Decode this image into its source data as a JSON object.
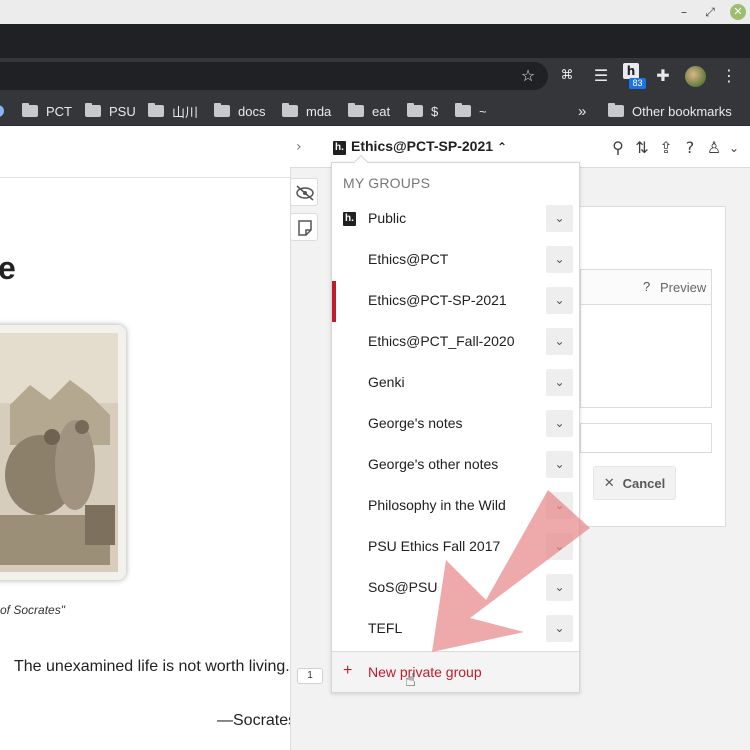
{
  "window": {
    "minimize": "–",
    "maximize": "⤢",
    "close": "✕"
  },
  "toolbar": {
    "star_icon": "☆",
    "ext_icons": [
      "⌘",
      "☰",
      "h"
    ],
    "ext_badge": "83",
    "puzzle_icon": "✚",
    "menu_icon": "⋮"
  },
  "bookmarks": {
    "items": [
      {
        "label": "PCT"
      },
      {
        "label": "PSU"
      },
      {
        "label": "山川"
      },
      {
        "label": "docs"
      },
      {
        "label": "mda"
      },
      {
        "label": "eat"
      },
      {
        "label": "$"
      },
      {
        "label": "~"
      }
    ],
    "overflow": "»",
    "other_label": "Other bookmarks"
  },
  "page": {
    "heading_fragment": "e",
    "caption": "of Socrates\"",
    "quote": "The unexamined life is not worth living.",
    "quote_source": "—Socrates",
    "annotation_count": "1"
  },
  "sidebar": {
    "collapse_icon": "›",
    "group_selector": {
      "name": "Ethics@PCT-SP-2021",
      "chevron": "⌃"
    },
    "icons": {
      "search": "⚲",
      "sort": "⇅",
      "share": "⇪",
      "help": "?",
      "user": "♙",
      "user_chevron": "⌄"
    },
    "menu": {
      "heading": "MY GROUPS",
      "groups": [
        {
          "label": "Public"
        },
        {
          "label": "Ethics@PCT"
        },
        {
          "label": "Ethics@PCT-SP-2021"
        },
        {
          "label": "Ethics@PCT_Fall-2020"
        },
        {
          "label": "Genki"
        },
        {
          "label": "George's notes"
        },
        {
          "label": "George's other notes"
        },
        {
          "label": "Philosophy in the Wild"
        },
        {
          "label": "PSU Ethics Fall 2017"
        },
        {
          "label": "SoS@PSU"
        },
        {
          "label": "TEFL"
        }
      ],
      "submenu_icon": "⌄",
      "new_group_plus": "+",
      "new_group_label": "New private group"
    },
    "card": {
      "help": "?",
      "preview": "Preview",
      "cancel": "Cancel",
      "cancel_icon": "✕"
    },
    "logo_letter": "h."
  },
  "colors": {
    "accent": "#bd1c2b",
    "arrow": "#e8888a"
  }
}
